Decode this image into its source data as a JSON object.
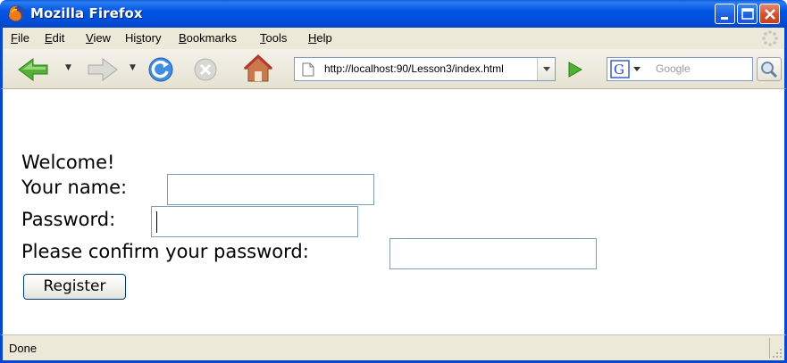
{
  "window": {
    "title": "Mozilla Firefox",
    "title_bar_color": "#0054e3"
  },
  "menu": {
    "items": [
      {
        "label": "File",
        "hotkey": "F"
      },
      {
        "label": "Edit",
        "hotkey": "E"
      },
      {
        "label": "View",
        "hotkey": "V"
      },
      {
        "label": "History",
        "hotkey": "s"
      },
      {
        "label": "Bookmarks",
        "hotkey": "B"
      },
      {
        "label": "Tools",
        "hotkey": "T"
      },
      {
        "label": "Help",
        "hotkey": "H"
      }
    ]
  },
  "toolbar": {
    "icons": [
      "back-arrow-icon",
      "forward-arrow-icon",
      "reload-icon",
      "stop-icon",
      "home-icon"
    ],
    "url": "http://localhost:90/Lesson3/index.html",
    "search_engine": "G",
    "search_placeholder": "Google"
  },
  "page": {
    "welcome": "Welcome!",
    "name_label": "Your name:",
    "name_value": "",
    "password_label": "Password:",
    "password_value": "",
    "confirm_label": "Please confirm your password:",
    "confirm_value": "",
    "register_label": "Register"
  },
  "status": {
    "text": "Done"
  },
  "colors": {
    "xp_blue": "#0848cc",
    "chrome": "#ece9d8",
    "input_border": "#7f9db9"
  }
}
